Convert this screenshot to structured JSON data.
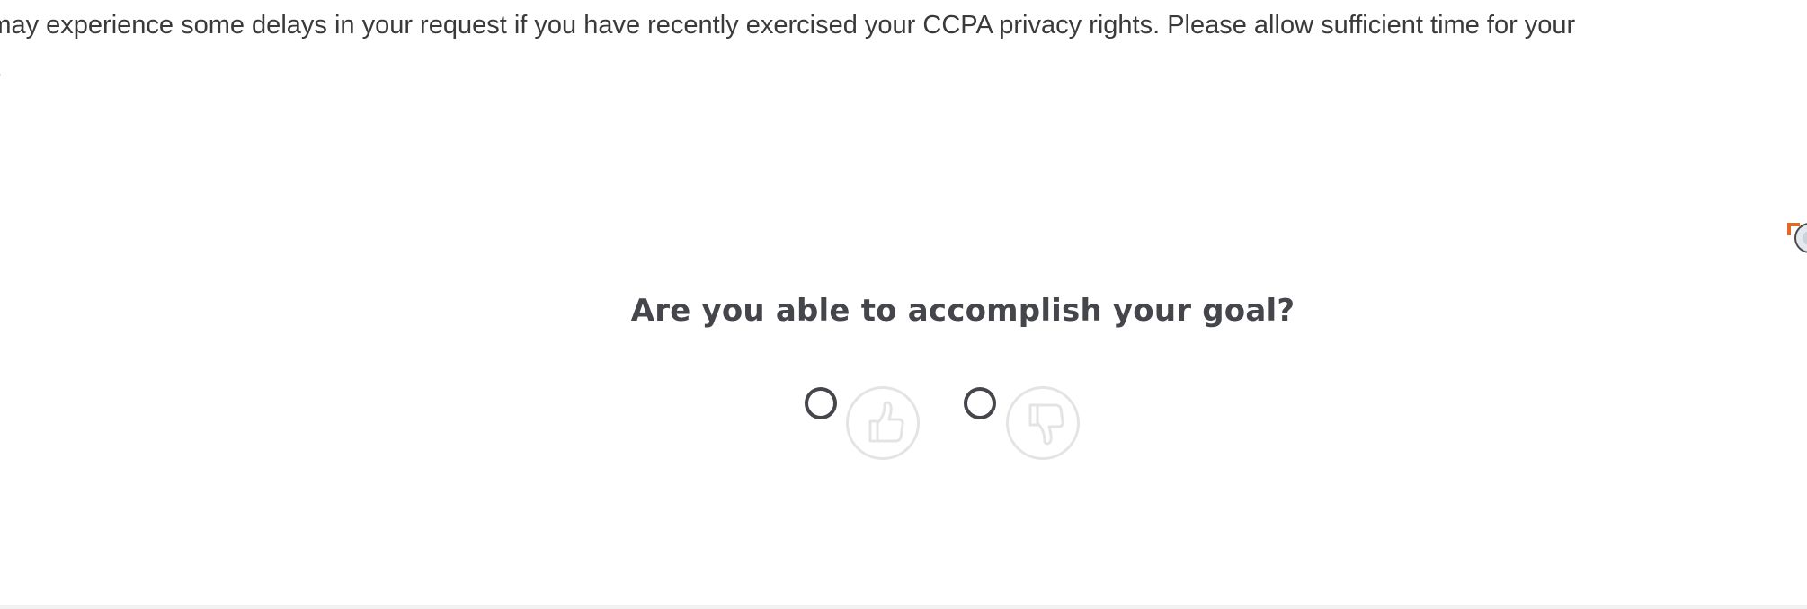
{
  "notice": {
    "line1": "ou may experience some delays in your request if you have recently exercised your CCPA privacy rights. Please allow sufficient time for your",
    "line2": "sed."
  },
  "feedback": {
    "question": "Are you able to accomplish your goal?",
    "options": [
      {
        "value": "yes",
        "icon": "thumbs-up-icon",
        "selected": false
      },
      {
        "value": "no",
        "icon": "thumbs-down-icon",
        "selected": false
      }
    ]
  },
  "colors": {
    "heading": "#45464b",
    "text": "#3a3a3a",
    "icon_stroke": "#e4e4e4",
    "accent": "#e0682a"
  }
}
